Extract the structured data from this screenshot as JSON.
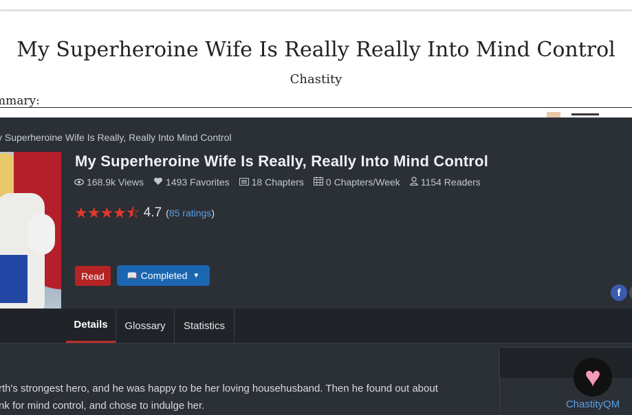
{
  "document": {
    "title": "My Superheroine Wife Is Really Really Into Mind Control",
    "author": "Chastity",
    "summary_label": "mmary:"
  },
  "breadcrumb": "y Superheroine Wife Is Really, Really Into Mind Control",
  "novel": {
    "title": "My Superheroine Wife Is Really, Really Into Mind Control",
    "stats": {
      "views": "168.9k Views",
      "favorites": "1493 Favorites",
      "chapters": "18 Chapters",
      "chapters_per_week": "0 Chapters/Week",
      "readers": "1154 Readers"
    },
    "rating": {
      "value": "4.7",
      "count": "85 ratings",
      "stars": 4.7
    }
  },
  "buttons": {
    "read": "Read",
    "status": "Completed"
  },
  "tabs": [
    {
      "label": "Details",
      "active": true
    },
    {
      "label": "Glossary",
      "active": false
    },
    {
      "label": "Statistics",
      "active": false
    }
  ],
  "description": {
    "line1": "rth's strongest hero, and he was happy to be her loving househusband. Then he found out about",
    "line2": "nk for mind control, and chose to indulge her."
  },
  "author_card": {
    "username": "ChastityQM"
  },
  "colors": {
    "accent_red": "#c22c2c",
    "accent_blue": "#1b66b0",
    "link_blue": "#5aa0e6",
    "dark_bg": "#2b2f36",
    "star_red": "#e2382c"
  },
  "icons": {
    "views": "eye-icon",
    "favorites": "heart-icon",
    "chapters": "list-icon",
    "schedule": "calendar-icon",
    "readers": "user-icon",
    "status_button": "book-icon",
    "social": "facebook-icon"
  }
}
